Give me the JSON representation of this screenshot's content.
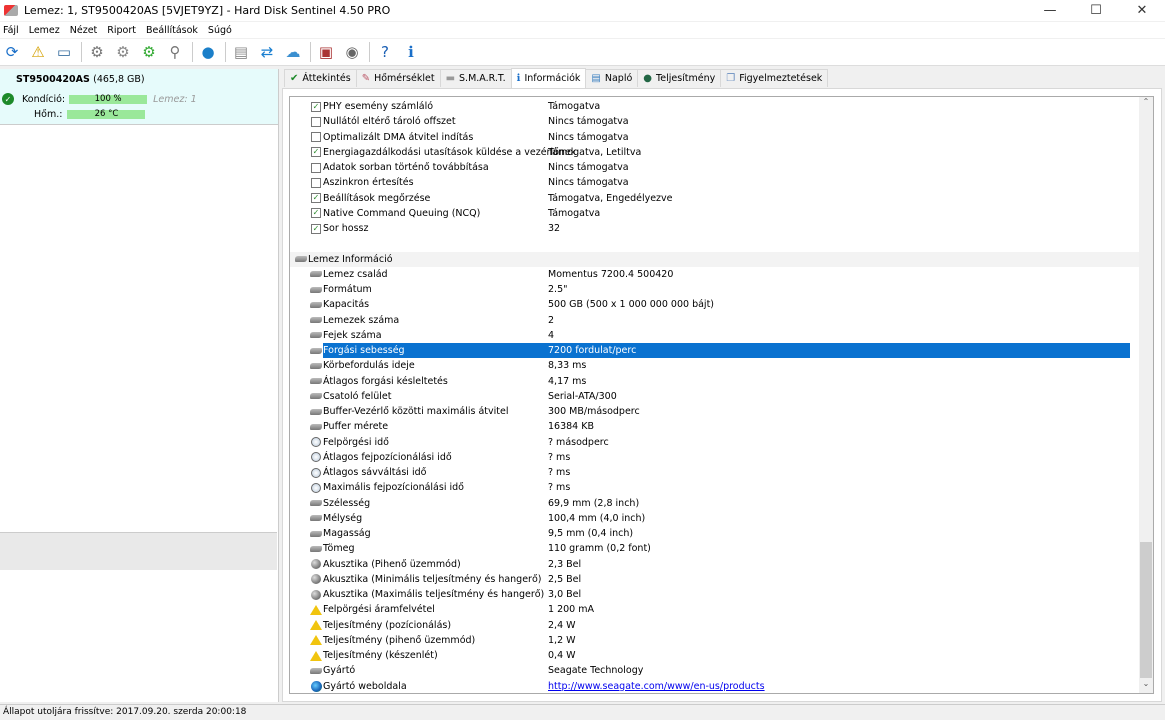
{
  "window": {
    "title": "Lemez: 1, ST9500420AS [5VJET9YZ]  -  Hard Disk Sentinel 4.50 PRO",
    "minimize": "—",
    "maximize": "☐",
    "close": "✕"
  },
  "menu": [
    "Fájl",
    "Lemez",
    "Nézet",
    "Riport",
    "Beállítások",
    "Súgó"
  ],
  "toolbar_icons": [
    "refresh-icon",
    "alert-icon",
    "disk-image-icon",
    "disk-test-icon",
    "disk-surface-icon",
    "disk-ok-icon",
    "disk-search-icon",
    "network-disk-icon",
    "report-icon",
    "sync-icon",
    "cloud-icon",
    "monitor-icon",
    "speaker-icon",
    "help-icon",
    "info-icon"
  ],
  "disk": {
    "name": "ST9500420AS",
    "size": "(465,8 GB)",
    "condition_label": "Kondíció:",
    "condition_value": "100 %",
    "condition_percent": 100,
    "disk_label": "Lemez: 1",
    "temp_label": "Hőm.:",
    "temp_value": "26 °C"
  },
  "tabs": [
    {
      "label": "Áttekintés",
      "icon": "check-icon"
    },
    {
      "label": "Hőmérséklet",
      "icon": "thermometer-icon"
    },
    {
      "label": "S.M.A.R.T.",
      "icon": "disk-icon"
    },
    {
      "label": "Információk",
      "icon": "info-icon",
      "active": true
    },
    {
      "label": "Napló",
      "icon": "log-icon"
    },
    {
      "label": "Teljesítmény",
      "icon": "performance-icon"
    },
    {
      "label": "Figyelmeztetések",
      "icon": "alerts-icon"
    }
  ],
  "rows": [
    {
      "type": "check",
      "checked": true,
      "label": "PHY esemény számláló",
      "value": "Támogatva"
    },
    {
      "type": "check",
      "checked": false,
      "label": "Nullától eltérő tároló offszet",
      "value": "Nincs támogatva"
    },
    {
      "type": "check",
      "checked": false,
      "label": "Optimalizált DMA átvitel indítás",
      "value": "Nincs támogatva"
    },
    {
      "type": "check",
      "checked": true,
      "label": "Energiagazdálkodási utasítások küldése a vezérlőnek",
      "value": "Támogatva, Letiltva"
    },
    {
      "type": "check",
      "checked": false,
      "label": "Adatok sorban történő továbbítása",
      "value": "Nincs támogatva"
    },
    {
      "type": "check",
      "checked": false,
      "label": "Aszinkron értesítés",
      "value": "Nincs támogatva"
    },
    {
      "type": "check",
      "checked": true,
      "label": "Beállítások megőrzése",
      "value": "Támogatva, Engedélyezve"
    },
    {
      "type": "check",
      "checked": true,
      "label": "Native Command Queuing (NCQ)",
      "value": "Támogatva"
    },
    {
      "type": "check",
      "checked": true,
      "label": "Sor hossz",
      "value": "32"
    },
    {
      "type": "blank"
    },
    {
      "type": "header",
      "icon": "hdd",
      "label": "Lemez Információ"
    },
    {
      "type": "item",
      "icon": "hdd",
      "label": "Lemez család",
      "value": "Momentus 7200.4 500420"
    },
    {
      "type": "item",
      "icon": "hdd",
      "label": "Formátum",
      "value": "2.5\""
    },
    {
      "type": "item",
      "icon": "hdd",
      "label": "Kapacitás",
      "value": "500 GB (500 x 1 000 000 000 bájt)"
    },
    {
      "type": "item",
      "icon": "hdd",
      "label": "Lemezek száma",
      "value": "2"
    },
    {
      "type": "item",
      "icon": "hdd",
      "label": "Fejek száma",
      "value": "4"
    },
    {
      "type": "item",
      "icon": "hdd",
      "label": "Forgási sebesség",
      "value": "7200 fordulat/perc",
      "selected": true
    },
    {
      "type": "item",
      "icon": "hdd",
      "label": "Körbefordulás ideje",
      "value": "8,33 ms"
    },
    {
      "type": "item",
      "icon": "hdd",
      "label": "Átlagos forgási késleltetés",
      "value": "4,17 ms"
    },
    {
      "type": "item",
      "icon": "hdd",
      "label": "Csatoló felület",
      "value": "Serial-ATA/300"
    },
    {
      "type": "item",
      "icon": "hdd",
      "label": "Buffer-Vezérlő közötti maximális átvitel",
      "value": "300 MB/másodperc"
    },
    {
      "type": "item",
      "icon": "hdd",
      "label": "Puffer mérete",
      "value": "16384 KB"
    },
    {
      "type": "item",
      "icon": "clock",
      "label": "Felpörgési idő",
      "value": "? másodperc"
    },
    {
      "type": "item",
      "icon": "clock",
      "label": "Átlagos fejpozícionálási idő",
      "value": "? ms"
    },
    {
      "type": "item",
      "icon": "clock",
      "label": "Átlagos sávváltási idő",
      "value": "? ms"
    },
    {
      "type": "item",
      "icon": "clock",
      "label": "Maximális fejpozícionálási idő",
      "value": "? ms"
    },
    {
      "type": "item",
      "icon": "hdd",
      "label": "Szélesség",
      "value": "69,9 mm (2,8 inch)"
    },
    {
      "type": "item",
      "icon": "hdd",
      "label": "Mélység",
      "value": "100,4 mm (4,0 inch)"
    },
    {
      "type": "item",
      "icon": "hdd",
      "label": "Magasság",
      "value": "9,5 mm (0,4 inch)"
    },
    {
      "type": "item",
      "icon": "hdd",
      "label": "Tömeg",
      "value": "110 gramm (0,2 font)"
    },
    {
      "type": "item",
      "icon": "spk",
      "label": "Akusztika (Pihenő üzemmód)",
      "value": "2,3 Bel"
    },
    {
      "type": "item",
      "icon": "spk",
      "label": "Akusztika (Minimális teljesítmény és hangerő)",
      "value": "2,5 Bel"
    },
    {
      "type": "item",
      "icon": "spk",
      "label": "Akusztika (Maximális teljesítmény és hangerő)",
      "value": "3,0 Bel"
    },
    {
      "type": "item",
      "icon": "warn",
      "label": "Felpörgési áramfelvétel",
      "value": "1 200 mA"
    },
    {
      "type": "item",
      "icon": "warn",
      "label": "Teljesítmény (pozícionálás)",
      "value": "2,4 W"
    },
    {
      "type": "item",
      "icon": "warn",
      "label": "Teljesítmény (pihenő üzemmód)",
      "value": "1,2 W"
    },
    {
      "type": "item",
      "icon": "warn",
      "label": "Teljesítmény (készenlét)",
      "value": "0,4 W"
    },
    {
      "type": "item",
      "icon": "hdd",
      "label": "Gyártó",
      "value": "Seagate Technology"
    },
    {
      "type": "item",
      "icon": "globe",
      "label": "Gyártó weboldala",
      "value": "http://www.seagate.com/www/en-us/products",
      "link": true
    }
  ],
  "status": "Állapot utoljára frissítve: 2017.09.20. szerda 20:00:18",
  "colors": {
    "selection": "#0a72d0",
    "condition_bar": "#9ae89a",
    "disk_panel": "#e6fbfb"
  }
}
